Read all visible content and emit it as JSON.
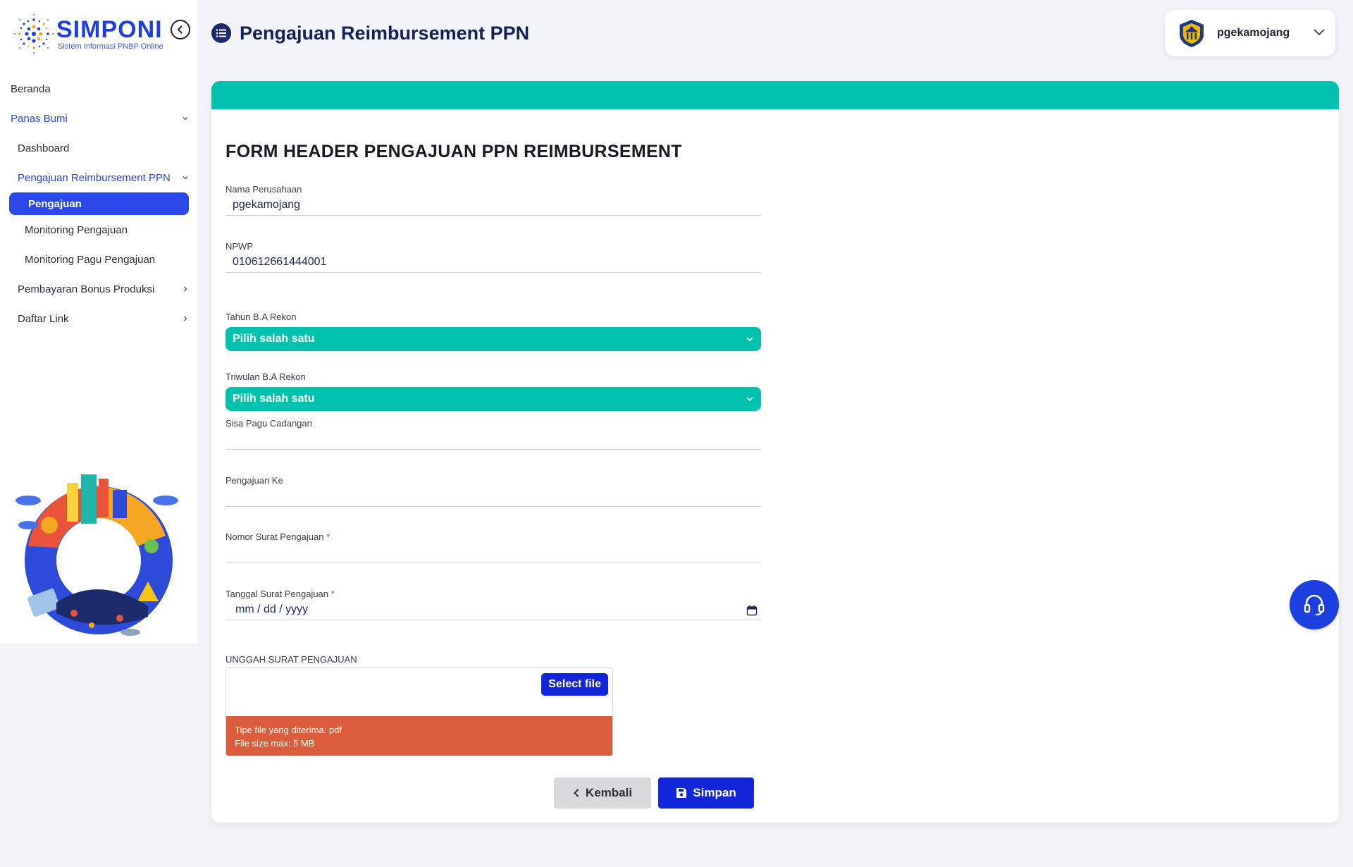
{
  "brand": {
    "name": "SIMPONI",
    "subtitle": "Sistem Informasi PNBP Online"
  },
  "header": {
    "title": "Pengajuan Reimbursement PPN"
  },
  "user": {
    "name": "pgekamojang"
  },
  "sidebar": {
    "items": [
      {
        "label": "Beranda"
      },
      {
        "label": "Panas Bumi"
      },
      {
        "label": "Dashboard"
      },
      {
        "label": "Pengajuan Reimbursement PPN"
      },
      {
        "label": "Pengajuan"
      },
      {
        "label": "Monitoring Pengajuan"
      },
      {
        "label": "Monitoring Pagu Pengajuan"
      },
      {
        "label": "Pembayaran Bonus Produksi"
      },
      {
        "label": "Daftar Link"
      }
    ]
  },
  "form": {
    "title": "FORM HEADER PENGAJUAN PPN REIMBURSEMENT",
    "nama_perusahaan": {
      "label": "Nama Perusahaan",
      "value": "pgekamojang"
    },
    "npwp": {
      "label": "NPWP",
      "value": "010612661444001"
    },
    "tahun": {
      "label": "Tahun B.A Rekon",
      "selected": "Pilih salah satu"
    },
    "triwulan": {
      "label": "Triwulan B.A Rekon",
      "selected": "Pilih salah satu"
    },
    "sisa_pagu": {
      "label": "Sisa Pagu Cadangan",
      "value": ""
    },
    "pengajuan_ke": {
      "label": "Pengajuan Ke",
      "value": ""
    },
    "nomor_surat": {
      "label": "Nomor Surat Pengajuan",
      "required_mark": "*",
      "value": ""
    },
    "tanggal_surat": {
      "label": "Tanggal Surat Pengajuan",
      "required_mark": "*",
      "placeholder": "mm / dd / yyyy"
    },
    "upload": {
      "label": "UNGGAH SURAT PENGAJUAN",
      "button": "Select file",
      "info_type": "Tipe file yang diterima: pdf",
      "info_size": "File size max: 5 MB"
    },
    "buttons": {
      "back": "Kembali",
      "save": "Simpan"
    }
  },
  "colors": {
    "accent_teal": "#00c2ad",
    "primary_blue": "#1325d8",
    "sidebar_selected": "#2a48e8",
    "warning_orange": "#db5c3a"
  },
  "icons": [
    "collapse-sidebar-icon",
    "list-icon",
    "ministry-logo-icon",
    "chevron-down-icon",
    "chevron-right-icon",
    "calendar-icon",
    "chevron-left-icon",
    "save-icon",
    "headset-icon"
  ]
}
